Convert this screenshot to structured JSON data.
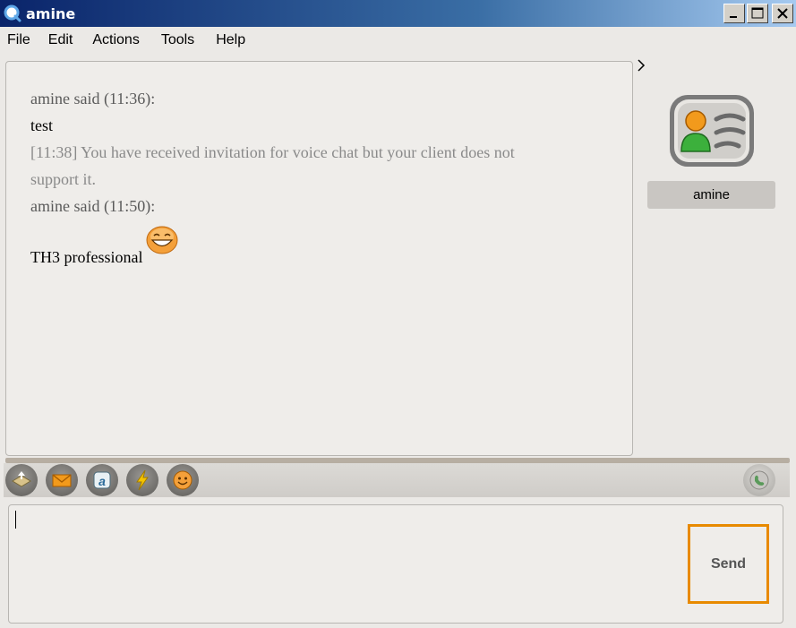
{
  "window": {
    "title": "amine",
    "controls": [
      "minimize",
      "maximize",
      "close"
    ]
  },
  "menu": {
    "items": [
      "File",
      "Edit",
      "Actions",
      "Tools",
      "Help"
    ]
  },
  "transcript": {
    "messages": [
      {
        "type": "header",
        "text": "amine said (11:36):"
      },
      {
        "type": "body",
        "text": "test"
      },
      {
        "type": "system",
        "text": "[11:38] You have received invitation for voice chat but your client does not"
      },
      {
        "type": "system",
        "text": "support it."
      },
      {
        "type": "header",
        "text": "amine said (11:50):"
      },
      {
        "type": "body",
        "text": "TH3 professional",
        "emoticon": "grin-smiley"
      }
    ]
  },
  "contact": {
    "name": "amine",
    "avatar_icon": "contact-card-icon"
  },
  "toolbar": {
    "buttons": [
      {
        "name": "transfer-file",
        "icon": "file-transfer-icon"
      },
      {
        "name": "send-email",
        "icon": "envelope-icon"
      },
      {
        "name": "change-font",
        "icon": "font-a-icon"
      },
      {
        "name": "send-nudge",
        "icon": "lightning-icon"
      },
      {
        "name": "emoticons",
        "icon": "smiley-icon"
      }
    ],
    "call_icon": "phone-call-icon"
  },
  "input": {
    "value": "",
    "send_label": "Send"
  },
  "colors": {
    "title_gradient_start": "#0a246a",
    "title_gradient_end": "#a6caf0",
    "send_border": "#e88a00",
    "system_text": "#8a8a8a"
  }
}
